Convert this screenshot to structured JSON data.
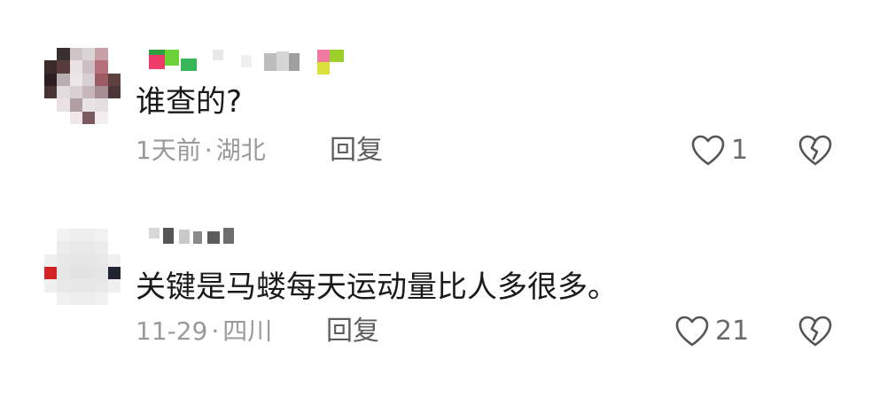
{
  "comments": [
    {
      "text": "谁查的?",
      "time": "1天前",
      "separator": "·",
      "location": "湖北",
      "reply_label": "回复",
      "like_count": "1",
      "icons": {
        "like": "heart-outline-icon",
        "dislike": "broken-heart-icon"
      }
    },
    {
      "text": "关键是马蝼每天运动量比人多很多。",
      "time": "11-29",
      "separator": "·",
      "location": "四川",
      "reply_label": "回复",
      "like_count": "21",
      "icons": {
        "like": "heart-outline-icon",
        "dislike": "broken-heart-icon"
      }
    }
  ],
  "colors": {
    "text": "#1a1a1a",
    "meta": "#9a9a9a",
    "reply": "#5e5e5e",
    "icon": "#555555"
  }
}
